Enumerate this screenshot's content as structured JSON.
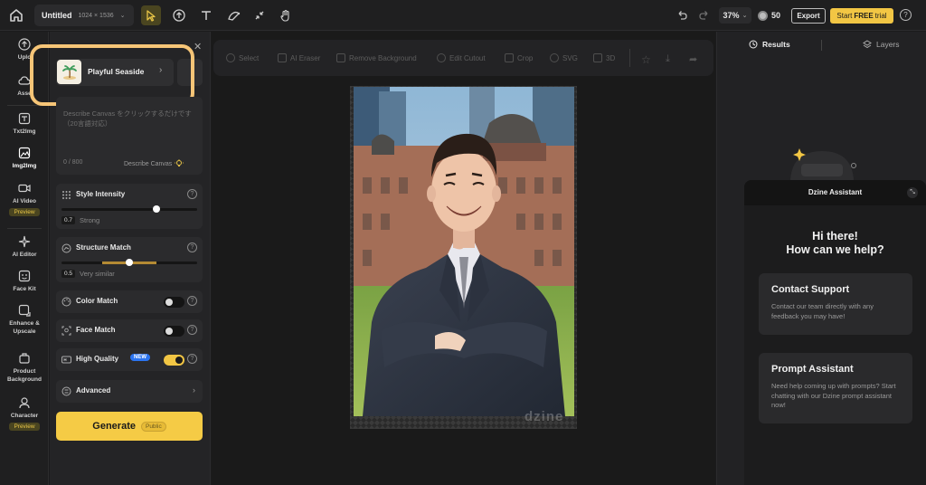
{
  "topbar": {
    "title": "Untitled",
    "dims": "1024 × 1536",
    "zoom": "37%",
    "credits": "50",
    "export_label": "Export",
    "trial_start": "Start",
    "trial_free": "FREE",
    "trial_end": "trial"
  },
  "leftnav": {
    "items": [
      {
        "label": "Uplo",
        "icon": "upload-icon"
      },
      {
        "label": "Asse",
        "icon": "cloud-icon"
      },
      {
        "label": "Txt2Img",
        "icon": "text-image-icon"
      },
      {
        "label": "Img2Img",
        "icon": "image-image-icon"
      },
      {
        "label": "AI Video",
        "icon": "video-icon",
        "badge": "Preview"
      },
      {
        "label": "AI Editor",
        "icon": "sparkle-icon"
      },
      {
        "label": "Face Kit",
        "icon": "face-icon"
      },
      {
        "label": "Enhance &",
        "label2": "Upscale",
        "icon": "enhance-icon"
      },
      {
        "label": "Product",
        "label2": "Background",
        "icon": "product-icon"
      },
      {
        "label": "Character",
        "icon": "character-icon",
        "badge": "Preview"
      }
    ]
  },
  "panel": {
    "style_name": "Playful Seaside",
    "prompt_placeholder": "Describe Canvas をクリックするだけです（20言語対応）",
    "prompt_count": "0 / 800",
    "describe_canvas": "Describe Canvas",
    "style_intensity": {
      "label": "Style Intensity",
      "value": "0.7",
      "value_text": "Strong",
      "level": 0.7
    },
    "structure_match": {
      "label": "Structure Match",
      "value": "0.5",
      "value_text": "Very similar",
      "level": 0.5
    },
    "color_match": {
      "label": "Color Match",
      "on": false
    },
    "face_match": {
      "label": "Face Match",
      "on": false
    },
    "high_quality": {
      "label": "High Quality",
      "badge": "NEW",
      "on": true
    },
    "advanced": "Advanced",
    "generate": "Generate",
    "generate_badge": "Public"
  },
  "canvas_toolbar": {
    "items": [
      "Select",
      "AI Eraser",
      "Remove Background",
      "Edit Cutout",
      "Crop",
      "SVG",
      "3D"
    ]
  },
  "canvas": {
    "watermark": "dzine"
  },
  "rightpanel": {
    "tab_results": "Results",
    "tab_layers": "Layers"
  },
  "assistant": {
    "title": "Dzine Assistant",
    "greeting_1": "Hi there!",
    "greeting_2": "How can we help?",
    "contact_title": "Contact Support",
    "contact_desc": "Contact our team directly with any feedback you may have!",
    "prompt_title": "Prompt Assistant",
    "prompt_desc": "Need help coming up with prompts? Start chatting with our Dzine prompt assistant now!"
  },
  "colors": {
    "accent": "#f5cb45",
    "highlight_ring": "#f6c577",
    "new_badge": "#2b74f0"
  }
}
